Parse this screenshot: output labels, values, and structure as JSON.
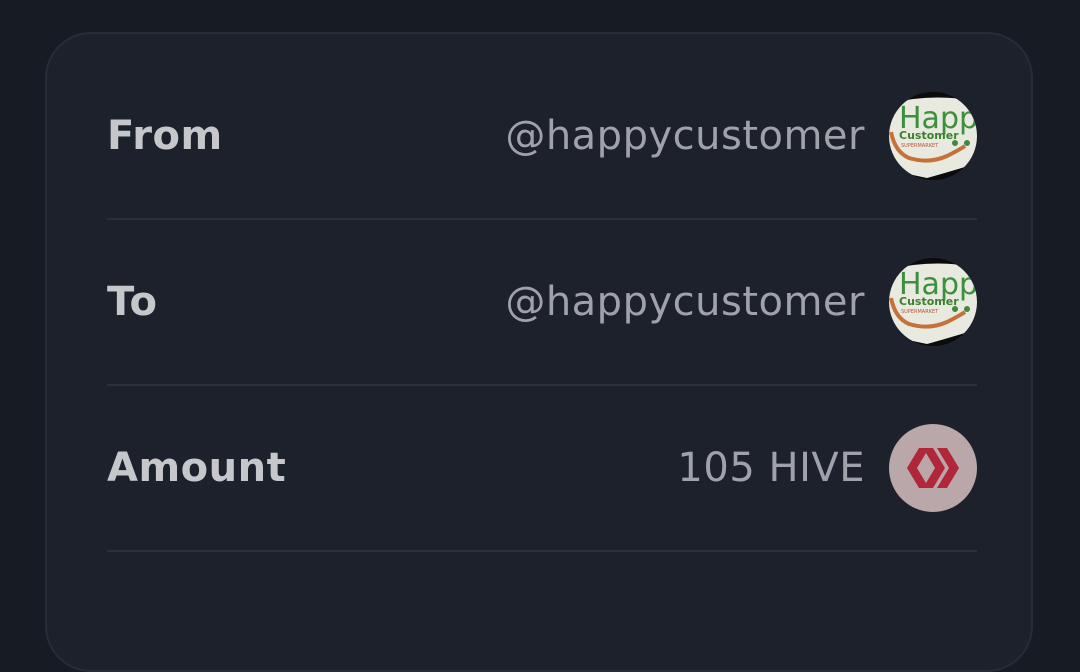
{
  "rows": [
    {
      "label": "From",
      "value": "@happycustomer",
      "icon": "user-avatar-icon",
      "avatar_text": {
        "line1": "Happ",
        "line2": "Customer",
        "line3": "SUPERMARKET"
      }
    },
    {
      "label": "To",
      "value": "@happycustomer",
      "icon": "user-avatar-icon",
      "avatar_text": {
        "line1": "Happ",
        "line2": "Customer",
        "line3": "SUPERMARKET"
      }
    },
    {
      "label": "Amount",
      "value": "105 HIVE",
      "icon": "hive-logo-icon"
    }
  ],
  "colors": {
    "background": "#171b23",
    "card": "#1c212c",
    "label": "#c5c7cb",
    "value": "#9fa2a8",
    "hive_red": "#b1273a",
    "hive_badge": "#b9a7aa"
  }
}
